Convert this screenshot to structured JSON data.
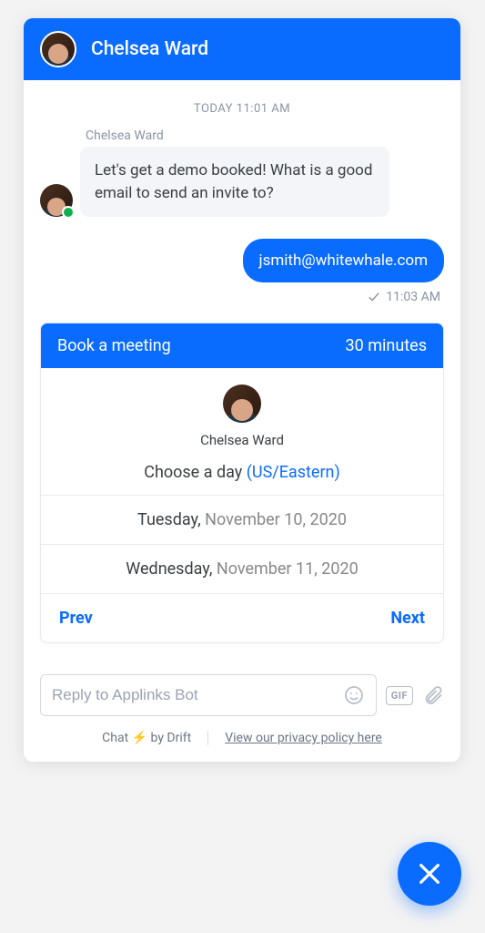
{
  "header": {
    "name": "Chelsea Ward"
  },
  "conversation": {
    "date_divider": "TODAY 11:01 AM",
    "sender_label": "Chelsea Ward",
    "incoming_text": "Let's get a demo booked! What is a good email to send an invite to?",
    "outgoing_text": "jsmith@whitewhale.com",
    "outgoing_time": "11:03 AM"
  },
  "meeting_card": {
    "title": "Book a meeting",
    "duration": "30 minutes",
    "host": "Chelsea Ward",
    "choose_label": "Choose a day ",
    "timezone": "(US/Eastern)",
    "options": [
      {
        "day": "Tuesday, ",
        "date": "November 10, 2020"
      },
      {
        "day": "Wednesday, ",
        "date": "November 11, 2020"
      }
    ],
    "prev": "Prev",
    "next": "Next"
  },
  "composer": {
    "placeholder": "Reply to Applinks Bot",
    "gif_label": "GIF"
  },
  "footer": {
    "powered_prefix": "Chat ",
    "powered_suffix": " by Drift",
    "privacy": "View our privacy policy here"
  }
}
